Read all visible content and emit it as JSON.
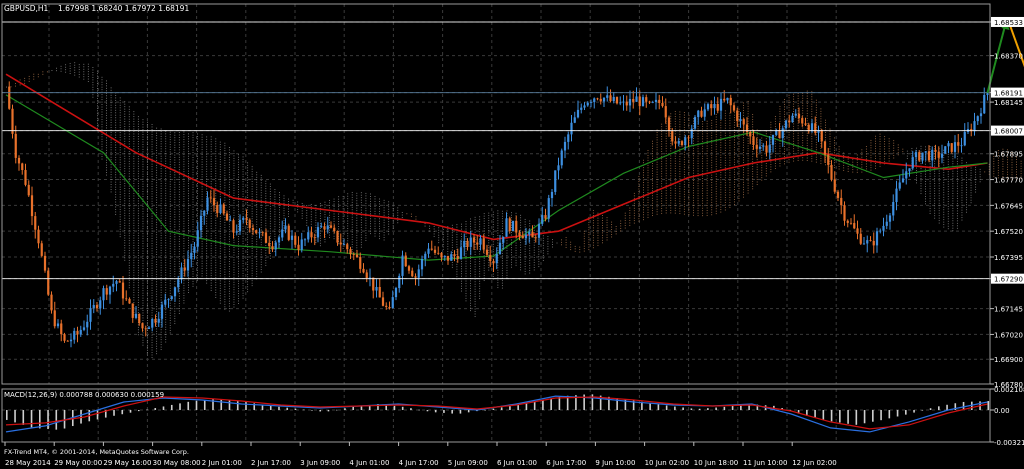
{
  "window": {
    "symbol_info": "GBPUSD,H1",
    "ohlc": "1.67998 1.68240 1.67972 1.68191",
    "copyright": "FX-Trend MT4, © 2001-2014, MetaQuotes Software Corp."
  },
  "colors": {
    "background": "#000000",
    "grid": "#3a3a3a",
    "bull_candle": "#3d8fe0",
    "bear_candle": "#e8712b",
    "ma_fast": "#cc1111",
    "ma_slow": "#1f8a1f",
    "cloud_dots_a": "#a0a0a0",
    "cloud_dots_b": "#c88a5a",
    "arrow_up": "#1f8a1f",
    "arrow_down": "#f0a000",
    "price_line": "#ffffff",
    "macd_hist": "#d0d0d0",
    "macd_main": "#2a6fe0",
    "macd_signal": "#cc1111"
  },
  "chart_data": [
    {
      "type": "candlestick",
      "name": "main",
      "y_ticks": [
        "1.68533",
        "1.68370",
        "1.68191",
        "1.68145",
        "1.68007",
        "1.67895",
        "1.67770",
        "1.67645",
        "1.67520",
        "1.67395",
        "1.67290",
        "1.67145",
        "1.67020",
        "1.66900",
        "1.66780"
      ],
      "highlighted_levels": [
        "1.68533",
        "1.68191",
        "1.68007",
        "1.67290"
      ],
      "ylim": [
        1.6678,
        1.6862
      ],
      "x_ticks": [
        "28 May 2014",
        "29 May 00:00",
        "29 May 16:00",
        "30 May 08:00",
        "2 Jun 01:00",
        "2 Jun 17:00",
        "3 Jun 09:00",
        "4 Jun 01:00",
        "4 Jun 17:00",
        "5 Jun 09:00",
        "6 Jun 01:00",
        "6 Jun 17:00",
        "9 Jun 10:00",
        "10 Jun 02:00",
        "10 Jun 18:00",
        "11 Jun 10:00",
        "12 Jun 02:00"
      ],
      "close_path": [
        [
          0,
          1.6822
        ],
        [
          3,
          1.679
        ],
        [
          6,
          1.6776
        ],
        [
          10,
          1.6748
        ],
        [
          14,
          1.6712
        ],
        [
          18,
          1.6698
        ],
        [
          22,
          1.6702
        ],
        [
          26,
          1.6712
        ],
        [
          30,
          1.6723
        ],
        [
          34,
          1.6728
        ],
        [
          38,
          1.6715
        ],
        [
          42,
          1.6705
        ],
        [
          46,
          1.671
        ],
        [
          50,
          1.672
        ],
        [
          54,
          1.6732
        ],
        [
          58,
          1.6745
        ],
        [
          62,
          1.6768
        ],
        [
          66,
          1.6762
        ],
        [
          70,
          1.6752
        ],
        [
          74,
          1.6758
        ],
        [
          78,
          1.675
        ],
        [
          82,
          1.6746
        ],
        [
          86,
          1.6752
        ],
        [
          90,
          1.6745
        ],
        [
          94,
          1.675
        ],
        [
          98,
          1.6755
        ],
        [
          102,
          1.6748
        ],
        [
          106,
          1.6742
        ],
        [
          110,
          1.6735
        ],
        [
          114,
          1.6722
        ],
        [
          118,
          1.6712
        ],
        [
          122,
          1.674
        ],
        [
          126,
          1.673
        ],
        [
          130,
          1.6745
        ],
        [
          134,
          1.6738
        ],
        [
          138,
          1.674
        ],
        [
          142,
          1.6746
        ],
        [
          146,
          1.6748
        ],
        [
          150,
          1.6738
        ],
        [
          154,
          1.6756
        ],
        [
          158,
          1.6752
        ],
        [
          162,
          1.6748
        ],
        [
          166,
          1.676
        ],
        [
          170,
          1.6785
        ],
        [
          174,
          1.6803
        ],
        [
          178,
          1.6815
        ],
        [
          182,
          1.6818
        ],
        [
          186,
          1.6815
        ],
        [
          190,
          1.6813
        ],
        [
          194,
          1.6816
        ],
        [
          198,
          1.6812
        ],
        [
          202,
          1.6815
        ],
        [
          206,
          1.6792
        ],
        [
          210,
          1.68
        ],
        [
          214,
          1.681
        ],
        [
          218,
          1.6812
        ],
        [
          222,
          1.6815
        ],
        [
          226,
          1.6805
        ],
        [
          230,
          1.6795
        ],
        [
          234,
          1.6792
        ],
        [
          238,
          1.68
        ],
        [
          242,
          1.6808
        ],
        [
          246,
          1.6805
        ],
        [
          250,
          1.6798
        ],
        [
          254,
          1.6778
        ],
        [
          258,
          1.676
        ],
        [
          262,
          1.675
        ],
        [
          266,
          1.6745
        ],
        [
          270,
          1.6755
        ],
        [
          274,
          1.677
        ],
        [
          278,
          1.6785
        ],
        [
          282,
          1.679
        ],
        [
          286,
          1.6788
        ],
        [
          290,
          1.6792
        ],
        [
          294,
          1.6795
        ],
        [
          298,
          1.6805
        ],
        [
          302,
          1.6819
        ]
      ],
      "moving_averages": [
        {
          "color_key": "ma_fast",
          "points": [
            [
              0,
              1.6828
            ],
            [
              40,
              1.679
            ],
            [
              70,
              1.6768
            ],
            [
              100,
              1.6762
            ],
            [
              130,
              1.6756
            ],
            [
              150,
              1.6748
            ],
            [
              170,
              1.6752
            ],
            [
              190,
              1.6765
            ],
            [
              210,
              1.6778
            ],
            [
              230,
              1.6785
            ],
            [
              250,
              1.679
            ],
            [
              270,
              1.6785
            ],
            [
              290,
              1.6782
            ],
            [
              302,
              1.6785
            ]
          ]
        },
        {
          "color_key": "ma_slow",
          "points": [
            [
              0,
              1.6818
            ],
            [
              30,
              1.679
            ],
            [
              50,
              1.6752
            ],
            [
              70,
              1.6745
            ],
            [
              100,
              1.6742
            ],
            [
              130,
              1.6738
            ],
            [
              150,
              1.674
            ],
            [
              170,
              1.6762
            ],
            [
              190,
              1.678
            ],
            [
              210,
              1.6793
            ],
            [
              230,
              1.68
            ],
            [
              250,
              1.679
            ],
            [
              270,
              1.6778
            ],
            [
              290,
              1.6783
            ],
            [
              302,
              1.6785
            ]
          ]
        }
      ]
    },
    {
      "type": "macd",
      "name": "MACD(12,26,9)",
      "label": "MACD(12,26,9) 0.000788 0.000630 0.000159",
      "y_ticks": [
        "0.002108",
        "0.00",
        "-0.003213"
      ],
      "ylim": [
        -0.003213,
        0.002108
      ],
      "histogram": [
        -0.001,
        -0.0018,
        -0.002,
        -0.0012,
        -0.0006,
        -0.0001,
        0.0004,
        0.0009,
        0.0011,
        0.0008,
        0.0004,
        0.0001,
        -0.0002,
        0.0003,
        0.0006,
        0.0003,
        -0.0002,
        -0.0004,
        0.0,
        0.0004,
        0.0009,
        0.0014,
        0.0016,
        0.0012,
        0.0008,
        0.0004,
        0.0001,
        0.0003,
        0.0006,
        0.0004,
        -0.0005,
        -0.0011,
        -0.0015,
        -0.001,
        -0.0004,
        0.0003,
        0.0008,
        0.0009
      ],
      "macd_line": [
        -0.0022,
        -0.0016,
        -0.0004,
        0.0008,
        0.0012,
        0.001,
        0.0006,
        0.0004,
        0.0002,
        0.0004,
        0.0006,
        0.0003,
        0.0,
        0.0006,
        0.0014,
        0.0012,
        0.0008,
        0.0005,
        0.0004,
        0.0006,
        -0.0004,
        -0.0018,
        -0.0022,
        -0.0012,
        0.0,
        0.0008
      ],
      "signal_line": [
        -0.0015,
        -0.0013,
        -0.0007,
        0.0004,
        0.0013,
        0.0012,
        0.0009,
        0.0005,
        0.0003,
        0.0004,
        0.0005,
        0.0004,
        0.0001,
        0.0005,
        0.0012,
        0.0013,
        0.001,
        0.0006,
        0.0004,
        0.0005,
        -0.0001,
        -0.0012,
        -0.0019,
        -0.0015,
        -0.0003,
        0.0006
      ]
    }
  ]
}
